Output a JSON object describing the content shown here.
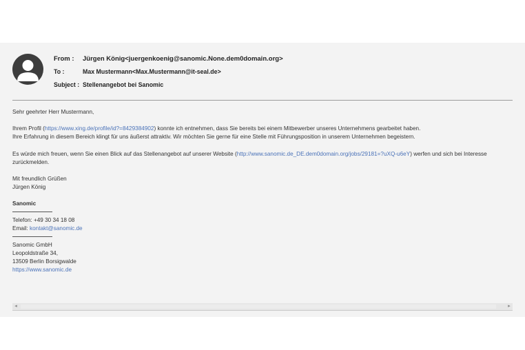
{
  "header": {
    "from_label": "From :",
    "from_value": "Jürgen König<juergenkoenig@sanomic.None.dem0domain.org>",
    "to_label": "To :",
    "to_value": "Max Mustermann<Max.Mustermann@it-seal.de>",
    "subject_label": "Subject :",
    "subject_value": "Stellenangebot bei Sanomic"
  },
  "body": {
    "greeting": "Sehr geehrter Herr Mustermann,",
    "p1_before_link": "Ihrem Profil (",
    "p1_link": "https://www.xing.de/profile/id?=8429384902",
    "p1_after_link": ") konnte ich entnehmen, dass Sie bereits bei einem Mitbewerber unseres Unternehmens gearbeitet haben.",
    "p1_line2": "Ihre Erfahrung in diesem Bereich klingt für uns äußerst attraktiv. Wir möchten Sie gerne für eine Stelle mit Führungsposition in unserem Unternehmen begeistern.",
    "p2_before_link": "Es würde mich freuen, wenn Sie einen Blick auf das Stellenangebot auf unserer Website (",
    "p2_link": "http://www.sanomic.de_DE.dem0domain.org/jobs/29181=?uXQ-u6eY",
    "p2_after_link": ") werfen und sich bei Interesse",
    "p2_line2": "zurückmelden.",
    "closing": "Mit freundlich Grüßen",
    "signer": "Jürgen König",
    "company_bold": "Sanomic",
    "phone": "Telefon: +49 30 34 18 08",
    "email_label": "Email: ",
    "email_link": "kontakt@sanomic.de",
    "company_full": "Sanomic GmbH",
    "street": "Leopoldstraße 34,",
    "city": "13509 Berlin Borsigwalde",
    "website": "https://www.sanomic.de"
  },
  "scrollbar": {
    "left_arrow": "◂",
    "right_arrow": "▸"
  },
  "colors": {
    "link": "#4a72b8",
    "panel": "#f3f3f3",
    "avatar": "#3d3d3d"
  },
  "icons": {
    "avatar": "user-avatar-icon"
  }
}
